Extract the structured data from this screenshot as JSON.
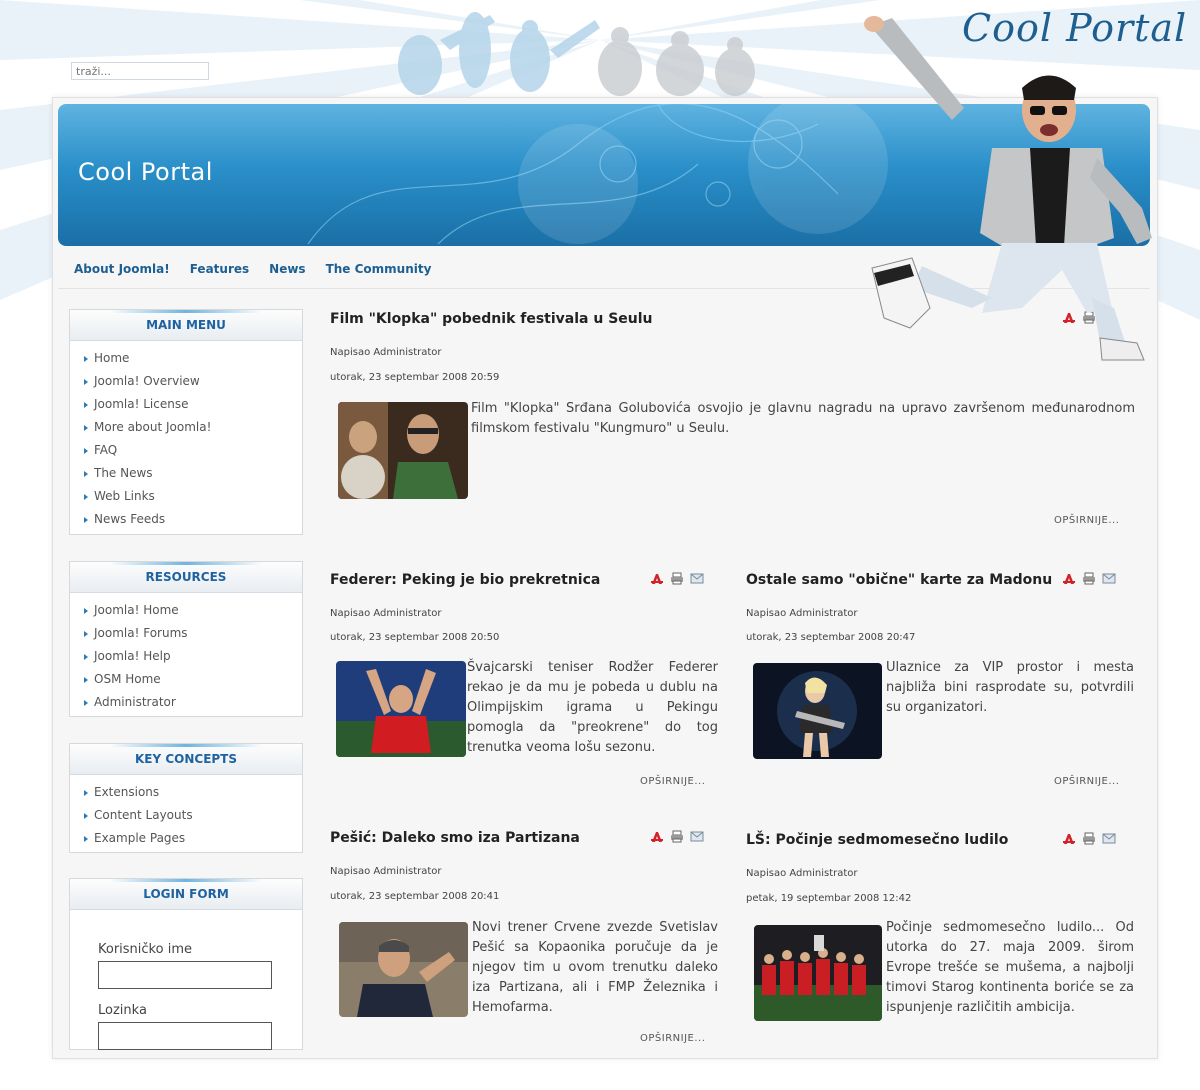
{
  "search": {
    "placeholder": "traži..."
  },
  "brand": {
    "script_title": "Cool Portal",
    "banner_title": "Cool Portal"
  },
  "topnav": [
    "About Joomla!",
    "Features",
    "News",
    "The Community"
  ],
  "modules": {
    "main_menu": {
      "title": "MAIN MENU",
      "items": [
        "Home",
        "Joomla! Overview",
        "Joomla! License",
        "More about Joomla!",
        "FAQ",
        "The News",
        "Web Links",
        "News Feeds"
      ]
    },
    "resources": {
      "title": "RESOURCES",
      "items": [
        "Joomla! Home",
        "Joomla! Forums",
        "Joomla! Help",
        "OSM Home",
        "Administrator"
      ]
    },
    "key_concepts": {
      "title": "KEY CONCEPTS",
      "items": [
        "Extensions",
        "Content Layouts",
        "Example Pages"
      ]
    },
    "login": {
      "title": "LOGIN FORM",
      "username_label": "Korisničko ime",
      "password_label": "Lozinka"
    }
  },
  "articles": [
    {
      "title": "Film \"Klopka\" pobednik festivala u Seulu",
      "author": "Napisao Administrator",
      "date": "utorak, 23 septembar 2008 20:59",
      "text": "Film \"Klopka\" Srđana Golubovića osvojio je glavnu nagradu na upravo završenom međunarodnom filmskom festivalu \"Kungmuro\" u Seulu.",
      "readmore": "OPŠIRNIJE..."
    },
    {
      "title": "Federer: Peking je bio prekretnica",
      "author": "Napisao Administrator",
      "date": "utorak, 23 septembar 2008 20:50",
      "text": "Švajcarski teniser Rodžer Federer rekao je da mu je pobeda u dublu na Olimpijskim igrama u Pekingu pomogla da \"preokrene\" do tog trenutka veoma lošu sezonu.",
      "readmore": "OPŠIRNIJE..."
    },
    {
      "title": "Ostale samo \"obične\" karte za Madonu",
      "author": "Napisao Administrator",
      "date": "utorak, 23 septembar 2008 20:47",
      "text": "Ulaznice za VIP prostor i mesta najbliža bini rasprodate su, potvrdili su organizatori.",
      "readmore": "OPŠIRNIJE..."
    },
    {
      "title": "Pešić: Daleko smo iza Partizana",
      "author": "Napisao Administrator",
      "date": "utorak, 23 septembar 2008 20:41",
      "text": "Novi trener Crvene zvezde Svetislav Pešić sa Kopaonika poručuje da je njegov tim u ovom trenutku daleko iza Partizana, ali i FMP Železnika i Hemofarma.",
      "readmore": "OPŠIRNIJE..."
    },
    {
      "title": "LŠ: Počinje sedmomesečno ludilo",
      "author": "Napisao Administrator",
      "date": "petak, 19 septembar 2008 12:42",
      "text": "Počinje sedmomesečno ludilo... Od utorka do 27. maja 2009. širom Evrope trešće se mušema, a najbolji timovi Starog kontinenta boriće se za ispunjenje različitih ambicija.",
      "readmore": ""
    }
  ]
}
